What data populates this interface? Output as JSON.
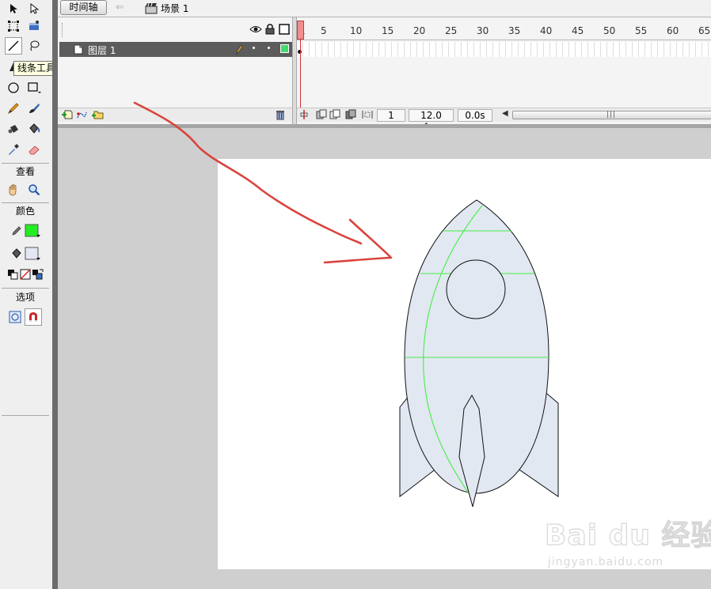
{
  "topbar": {
    "timeline_tab": "时间轴",
    "scene": "场景 1"
  },
  "toolbar": {
    "tooltip": "线条工具 (N)",
    "view_heading": "查看",
    "color_heading": "颜色",
    "options_heading": "选项",
    "stroke_color": "#22ee22",
    "fill_color": "#e2e8f2"
  },
  "timeline": {
    "layer_name": "图层 1",
    "frame_numbers": [
      "1",
      "5",
      "10",
      "15",
      "20",
      "25",
      "30",
      "35",
      "40",
      "45",
      "50",
      "55",
      "60",
      "65"
    ],
    "current_frame": "1",
    "fps": "12.0 fps",
    "elapsed": "0.0s"
  },
  "stage": {
    "rocket_fill": "#e2e8f2",
    "guide_color": "#44ee44",
    "annotation_color": "#d9453e"
  },
  "watermark": {
    "logo_text": "Bai du 经验",
    "url": "jingyan.baidu.com"
  }
}
